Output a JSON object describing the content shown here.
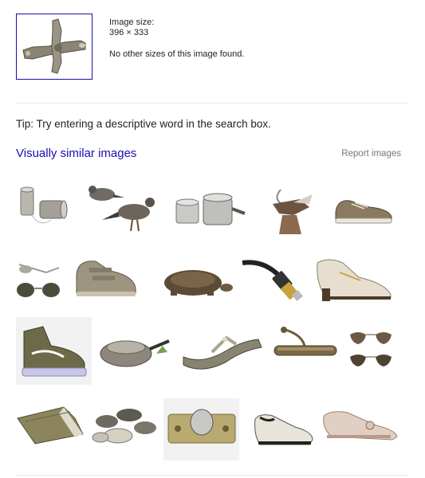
{
  "image_info": {
    "size_label": "Image size:",
    "size_value": "396 × 333",
    "other_sizes": "No other sizes of this image found."
  },
  "tip": "Tip: Try entering a descriptive word in the search box.",
  "similar": {
    "title": "Visually similar images",
    "report": "Report images"
  },
  "colors": {
    "link": "#1a0dab",
    "muted": "#777777",
    "divider": "#ebebeb"
  },
  "grid": [
    [
      "tin-can-telephone",
      "birds",
      "steel-pots",
      "bird-ornament",
      "sneaker"
    ],
    [
      "sunglasses",
      "velcro-shoe",
      "tortoise",
      "usb-cable",
      "loafer"
    ],
    [
      "high-top-sneaker",
      "frying-pan",
      "sandal",
      "picture-light",
      "aviator-sunglasses"
    ],
    [
      "sleeping-bag",
      "cookware-set",
      "door-hardware",
      "slip-on-shoe",
      "ballet-flat"
    ]
  ]
}
